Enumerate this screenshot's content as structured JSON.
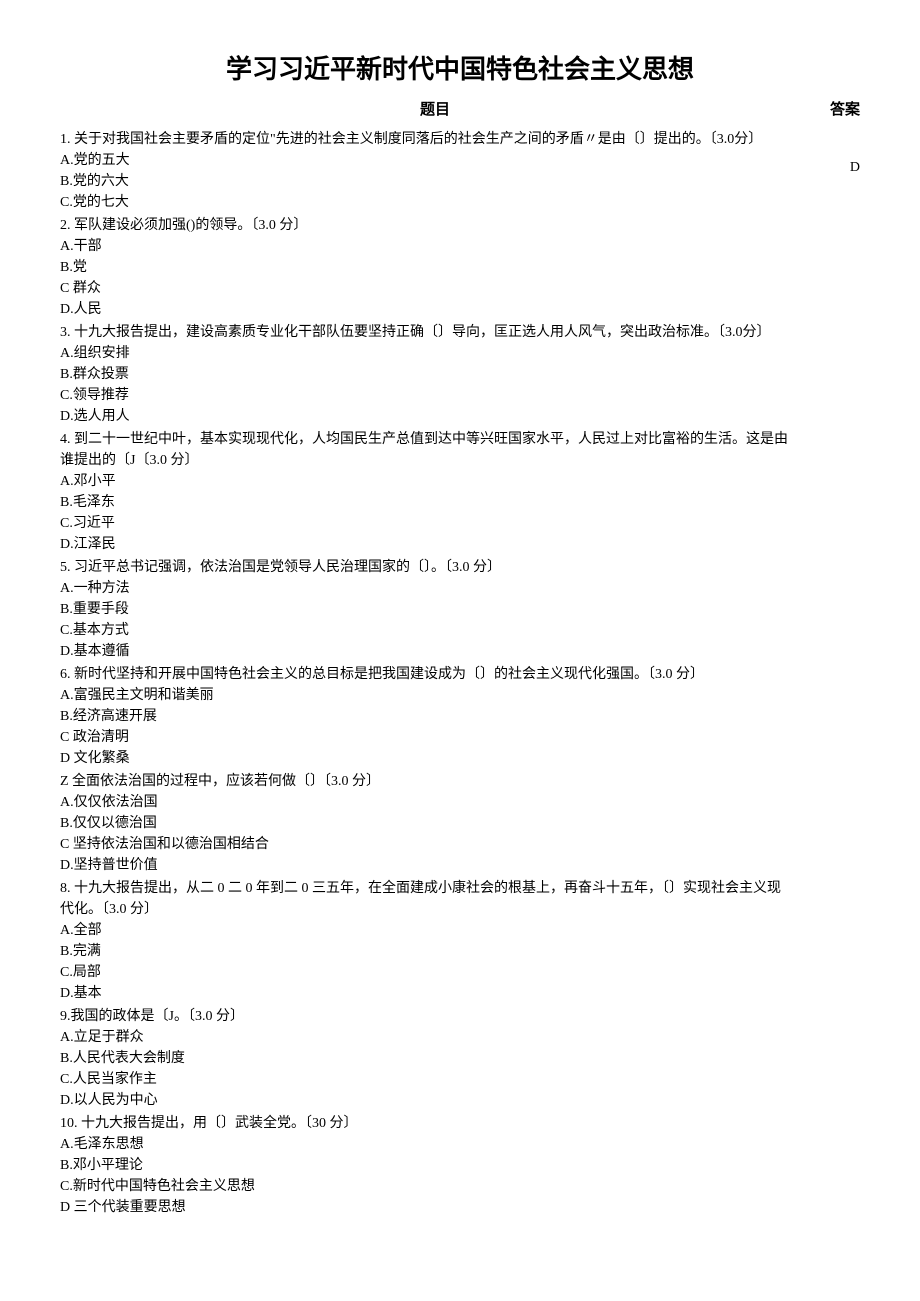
{
  "title": "学习习近平新时代中国特色社会主义思想",
  "header": {
    "question_label": "题目",
    "answer_label": "答案"
  },
  "answer": "D",
  "questions": [
    {
      "text": "1. 关于对我国社会主要矛盾的定位\"先进的社会主义制度同落后的社会生产之间的矛盾〃是由〔〕提出的。〔3.0分〕",
      "options": [
        "A.党的五大",
        "B.党的六大",
        "C.党的七大"
      ]
    },
    {
      "text": "2. 军队建设必须加强()的领导。〔3.0 分〕",
      "options": [
        "A.干部",
        "B.党",
        "C 群众",
        "D.人民"
      ]
    },
    {
      "text": "3. 十九大报告提出，建设高素质专业化干部队伍要坚持正确〔〕导向，匡正选人用人风气，突出政治标准。〔3.0分〕",
      "options": [
        "A.组织安排",
        "B.群众投票",
        "C.领导推荐",
        "D.选人用人"
      ]
    },
    {
      "text": "4. 到二十一世纪中叶，基本实现现代化，人均国民生产总值到达中等兴旺国家水平，人民过上对比富裕的生活。这是由谁提出的〔J〔3.0 分〕",
      "options": [
        "A.邓小平",
        "B.毛泽东",
        "C.习近平",
        "D.江泽民"
      ]
    },
    {
      "text": "5. 习近平总书记强调，依法治国是党领导人民治理国家的〔〕。〔3.0 分〕",
      "options": [
        "A.一种方法",
        "B.重要手段",
        "C.基本方式",
        "D.基本遵循"
      ]
    },
    {
      "text": "6. 新时代坚持和开展中国特色社会主义的总目标是把我国建设成为〔〕的社会主义现代化强国。〔3.0 分〕",
      "options": [
        "A.富强民主文明和谐美丽",
        "B.经济高速开展",
        "C 政治清明",
        "D 文化繁桑"
      ]
    },
    {
      "text": "Z 全面依法治国的过程中，应该若何做〔〕〔3.0 分〕",
      "options": [
        "A.仅仅依法治国",
        "B.仅仅以德治国",
        "C 坚持依法治国和以德治国相结合",
        "D.坚持普世价值"
      ]
    },
    {
      "text": "8. 十九大报告提出，从二 0 二 0 年到二 0 三五年，在全面建成小康社会的根基上，再奋斗十五年，〔〕实现社会主义现代化。〔3.0 分〕",
      "options": [
        "A.全部",
        "B.完满",
        "C.局部",
        "D.基本"
      ]
    },
    {
      "text": "9.我国的政体是〔J。〔3.0 分〕",
      "options": [
        "A.立足于群众",
        "B.人民代表大会制度",
        "C.人民当家作主",
        "D.以人民为中心"
      ]
    },
    {
      "text": "10. 十九大报告提出，用〔〕武装全党。〔30 分〕",
      "options": [
        "A.毛泽东思想",
        "B.邓小平理论",
        "C.新时代中国特色社会主义思想",
        "D 三个代装重要思想"
      ]
    }
  ]
}
